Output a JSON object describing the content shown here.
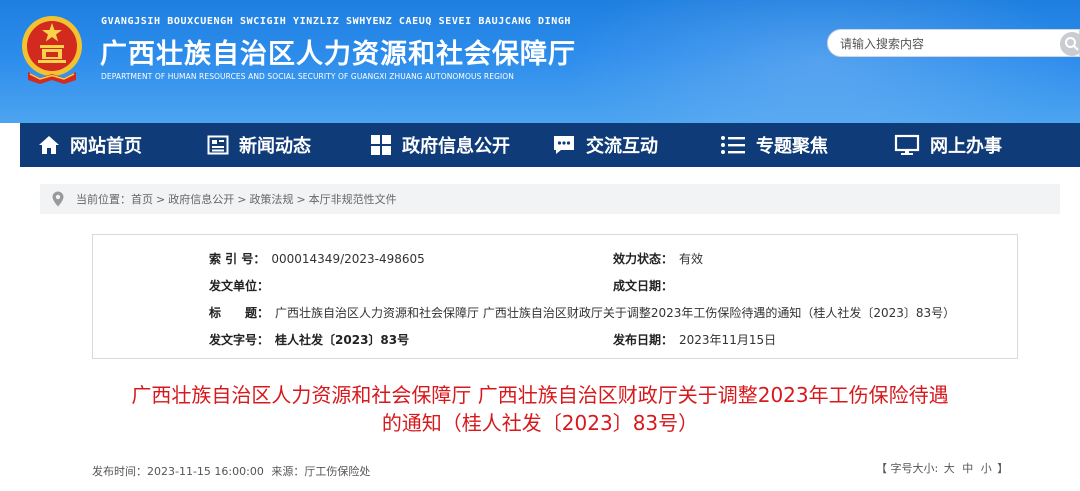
{
  "header": {
    "zhuang_name": "GVANGJSIH BOUXCUENGH SWCIGIH YINZLIZ SWHYENZ CAEUQ SEVEI BAUJCANG DINGH",
    "title": "广西壮族自治区人力资源和社会保障厅",
    "english_name": "DEPARTMENT OF HUMAN RESOURCES AND SOCIAL SECURITY OF GUANGXI ZHUANG AUTONOMOUS REGION",
    "emblem_icon": "national-emblem-icon",
    "search": {
      "placeholder": "请输入搜索内容",
      "button_icon": "search-icon"
    },
    "colors": {
      "banner": "#2c8cec",
      "nav": "#0f3b78",
      "title_red": "#d7191d"
    }
  },
  "nav": {
    "items": [
      {
        "label": "网站首页",
        "icon": "home-icon"
      },
      {
        "label": "新闻动态",
        "icon": "news-icon"
      },
      {
        "label": "政府信息公开",
        "icon": "grid-icon"
      },
      {
        "label": "交流互动",
        "icon": "chat-icon"
      },
      {
        "label": "专题聚焦",
        "icon": "list-icon"
      },
      {
        "label": "网上办事",
        "icon": "monitor-icon"
      }
    ]
  },
  "breadcrumb": {
    "prefix": "当前位置：",
    "items": [
      "首页",
      "政府信息公开",
      "政策法规",
      "本厅非规范性文件"
    ],
    "separator": ">",
    "icon": "location-pin-icon"
  },
  "meta": {
    "index_key": "索 引 号：",
    "index_val": "000014349/2023-498605",
    "status_key": "效力状态：",
    "status_val": "有效",
    "issuer_key": "发文单位：",
    "issuer_val": "",
    "date_made_key": "成文日期：",
    "date_made_val": "",
    "title_key": "标　　题：",
    "title_val": "广西壮族自治区人力资源和社会保障厅 广西壮族自治区财政厅关于调整2023年工伤保险待遇的通知（桂人社发〔2023〕83号）",
    "docno_key": "发文字号：",
    "docno_val": "桂人社发〔2023〕83号",
    "pub_date_key": "发布日期：",
    "pub_date_val": "2023年11月15日"
  },
  "article": {
    "title_line1": "广西壮族自治区人力资源和社会保障厅 广西壮族自治区财政厅关于调整2023年工伤保险待遇",
    "title_line2": "的通知（桂人社发〔2023〕83号）",
    "publish_time": "发布时间：2023-11-15 16:00:00",
    "source": "来源：厅工伤保险处",
    "font_size_label": "【 字号大小:",
    "font_large": "大",
    "font_medium": "中",
    "font_small": "小",
    "font_size_end": "】"
  }
}
